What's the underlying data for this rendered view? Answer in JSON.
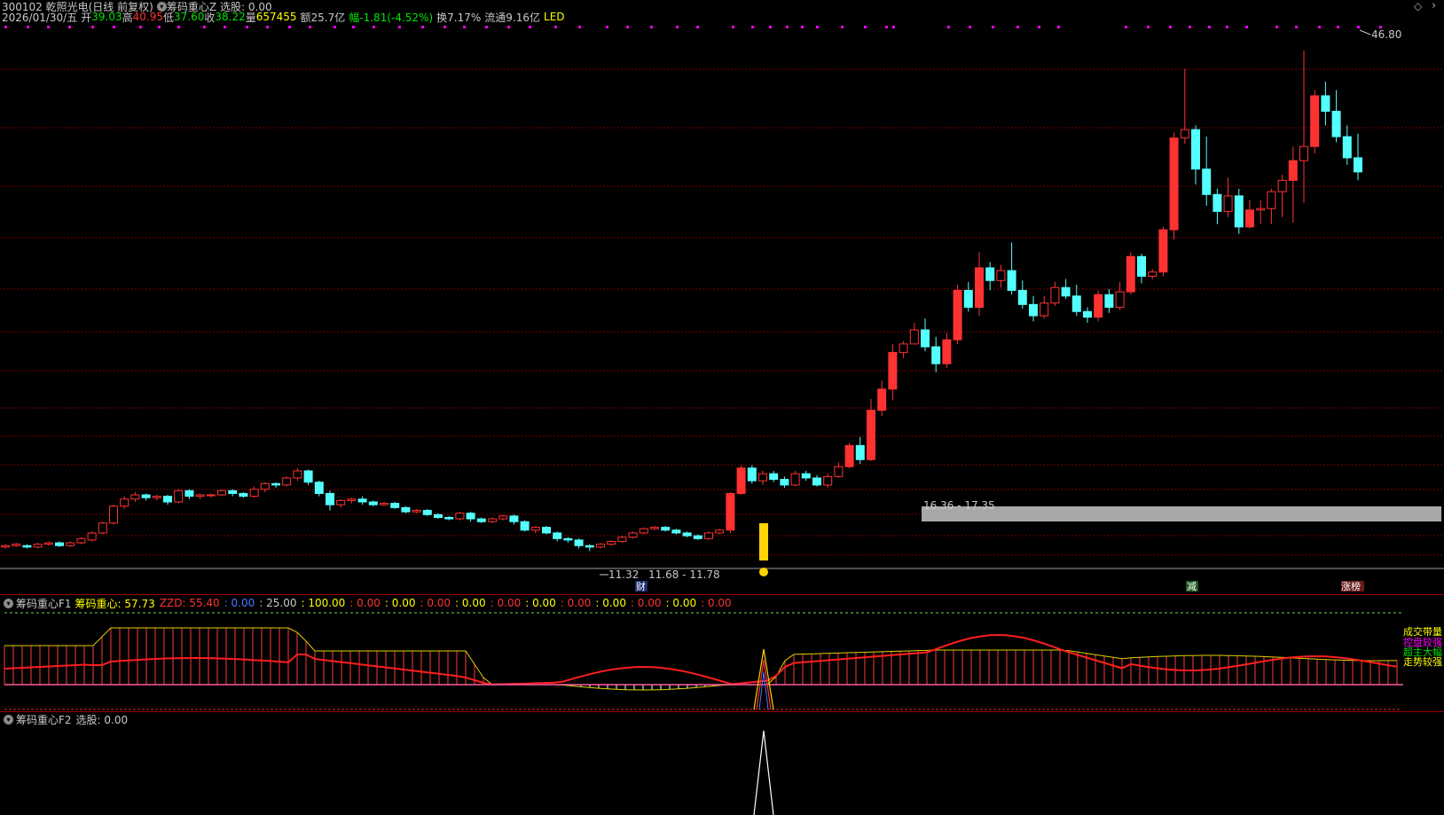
{
  "colors": {
    "up": "#ff3232",
    "down": "#54ffff",
    "grid": "#7a0000",
    "yellow": "#ffff00",
    "white": "#ffffff",
    "green": "#00e600",
    "magenta": "#ff00ff"
  },
  "header": {
    "title": "300102 乾照光电(日线 前复权)",
    "indicator_name": "筹码重心Z",
    "select_label": "选股: 0.00"
  },
  "info": {
    "date": "2026/01/30/五",
    "open_label": "开",
    "open": "39.03",
    "high_label": "高",
    "high": "40.95",
    "low_label": "低",
    "low": "37.60",
    "close_label": "收",
    "close": "38.22",
    "vol_label": "量",
    "vol": "657455",
    "amount": "额25.7亿",
    "change": "幅-1.81(-4.52%)",
    "turnover": "换7.17%",
    "float": "流通9.16亿",
    "sector": "LED"
  },
  "main_chart": {
    "high_mark": "46.80",
    "low_mark": "11.32",
    "low_range": "11.68 - 11.78",
    "band_range": "16.36 - 17.35",
    "event_cai": "财",
    "event_jian": "减",
    "event_zhangbang": "涨榜"
  },
  "chart_data": {
    "type": "candlestick",
    "price_range": [
      10.9,
      48.0
    ],
    "candles": [
      [
        11.6,
        11.7,
        11.5,
        11.8
      ],
      [
        11.7,
        11.8,
        11.6,
        11.9
      ],
      [
        11.7,
        11.6,
        11.5,
        11.8
      ],
      [
        11.6,
        11.8,
        11.5,
        11.9
      ],
      [
        11.8,
        11.9,
        11.7,
        12.0
      ],
      [
        11.9,
        11.7,
        11.6,
        12.0
      ],
      [
        11.7,
        11.9,
        11.6,
        12.0
      ],
      [
        11.9,
        12.2,
        11.8,
        12.3
      ],
      [
        12.1,
        12.6,
        12.0,
        12.7
      ],
      [
        12.6,
        13.3,
        12.5,
        13.4
      ],
      [
        13.3,
        14.5,
        13.2,
        14.6
      ],
      [
        14.5,
        15.0,
        14.3,
        15.2
      ],
      [
        15.0,
        15.3,
        14.8,
        15.5
      ],
      [
        15.3,
        15.1,
        14.9,
        15.4
      ],
      [
        15.1,
        15.2,
        14.9,
        15.3
      ],
      [
        15.2,
        14.8,
        14.6,
        15.3
      ],
      [
        14.8,
        15.6,
        14.7,
        15.7
      ],
      [
        15.6,
        15.2,
        15.0,
        15.7
      ],
      [
        15.2,
        15.3,
        15.0,
        15.4
      ],
      [
        15.3,
        15.3,
        15.1,
        15.4
      ],
      [
        15.3,
        15.6,
        15.2,
        15.7
      ],
      [
        15.6,
        15.4,
        15.2,
        15.7
      ],
      [
        15.4,
        15.2,
        15.1,
        15.5
      ],
      [
        15.2,
        15.7,
        15.1,
        15.9
      ],
      [
        15.7,
        16.1,
        15.5,
        16.2
      ],
      [
        16.1,
        16.0,
        15.8,
        16.2
      ],
      [
        16.0,
        16.5,
        15.9,
        16.6
      ],
      [
        16.5,
        17.0,
        16.3,
        17.2
      ],
      [
        17.0,
        16.2,
        16.0,
        17.1
      ],
      [
        16.2,
        15.4,
        15.2,
        16.3
      ],
      [
        15.4,
        14.6,
        14.2,
        15.6
      ],
      [
        14.6,
        14.9,
        14.4,
        15.0
      ],
      [
        14.9,
        15.0,
        14.7,
        15.1
      ],
      [
        15.0,
        14.8,
        14.6,
        15.2
      ],
      [
        14.8,
        14.6,
        14.5,
        14.9
      ],
      [
        14.6,
        14.7,
        14.5,
        14.8
      ],
      [
        14.7,
        14.4,
        14.3,
        14.8
      ],
      [
        14.4,
        14.1,
        14.0,
        14.5
      ],
      [
        14.1,
        14.2,
        14.0,
        14.3
      ],
      [
        14.2,
        13.9,
        13.8,
        14.3
      ],
      [
        13.9,
        13.7,
        13.6,
        14.0
      ],
      [
        13.7,
        13.6,
        13.5,
        13.8
      ],
      [
        13.6,
        14.0,
        13.5,
        14.1
      ],
      [
        14.0,
        13.6,
        13.4,
        14.1
      ],
      [
        13.6,
        13.4,
        13.3,
        13.7
      ],
      [
        13.4,
        13.6,
        13.3,
        13.7
      ],
      [
        13.6,
        13.8,
        13.5,
        13.9
      ],
      [
        13.8,
        13.4,
        13.2,
        13.9
      ],
      [
        13.4,
        12.8,
        12.7,
        13.5
      ],
      [
        12.8,
        13.0,
        12.6,
        13.1
      ],
      [
        13.0,
        12.6,
        12.5,
        13.1
      ],
      [
        12.6,
        12.2,
        12.0,
        12.7
      ],
      [
        12.2,
        12.1,
        11.9,
        12.3
      ],
      [
        12.1,
        11.7,
        11.5,
        12.2
      ],
      [
        11.7,
        11.6,
        11.32,
        11.8
      ],
      [
        11.6,
        11.8,
        11.5,
        11.9
      ],
      [
        11.8,
        12.0,
        11.7,
        12.1
      ],
      [
        12.0,
        12.3,
        11.9,
        12.4
      ],
      [
        12.3,
        12.6,
        12.2,
        12.7
      ],
      [
        12.6,
        12.9,
        12.5,
        13.0
      ],
      [
        12.9,
        13.0,
        12.8,
        13.1
      ],
      [
        13.0,
        12.8,
        12.7,
        13.1
      ],
      [
        12.8,
        12.6,
        12.5,
        12.9
      ],
      [
        12.6,
        12.4,
        12.3,
        12.7
      ],
      [
        12.4,
        12.2,
        12.1,
        12.5
      ],
      [
        12.2,
        12.6,
        12.1,
        12.7
      ],
      [
        12.6,
        12.8,
        12.5,
        12.9
      ],
      [
        12.8,
        15.4,
        12.6,
        15.5
      ],
      [
        15.4,
        17.2,
        15.3,
        17.4
      ],
      [
        17.2,
        16.3,
        16.1,
        17.4
      ],
      [
        16.3,
        16.8,
        16.0,
        17.0
      ],
      [
        16.8,
        16.4,
        16.2,
        17.0
      ],
      [
        16.4,
        16.0,
        15.8,
        16.6
      ],
      [
        16.0,
        16.8,
        15.9,
        17.0
      ],
      [
        16.8,
        16.5,
        16.3,
        17.0
      ],
      [
        16.5,
        16.0,
        15.9,
        16.7
      ],
      [
        16.0,
        16.6,
        15.8,
        16.8
      ],
      [
        16.6,
        17.3,
        16.5,
        17.6
      ],
      [
        17.3,
        18.8,
        17.2,
        19.0
      ],
      [
        18.8,
        17.8,
        17.5,
        19.4
      ],
      [
        17.8,
        21.3,
        17.7,
        22.1
      ],
      [
        21.3,
        22.8,
        20.9,
        23.4
      ],
      [
        22.8,
        25.4,
        22.0,
        26.0
      ],
      [
        25.4,
        26.0,
        25.0,
        26.2
      ],
      [
        26.0,
        27.0,
        26.0,
        27.5
      ],
      [
        27.0,
        25.8,
        25.5,
        27.8
      ],
      [
        25.8,
        24.6,
        24.0,
        26.5
      ],
      [
        24.6,
        26.3,
        24.3,
        26.8
      ],
      [
        26.3,
        29.8,
        26.0,
        30.2
      ],
      [
        29.8,
        28.6,
        28.3,
        30.4
      ],
      [
        28.6,
        31.4,
        28.0,
        32.5
      ],
      [
        31.4,
        30.5,
        29.8,
        31.8
      ],
      [
        30.5,
        31.2,
        30.0,
        31.6
      ],
      [
        31.2,
        29.8,
        29.5,
        33.2
      ],
      [
        29.8,
        28.8,
        28.5,
        30.5
      ],
      [
        28.8,
        28.0,
        27.6,
        29.4
      ],
      [
        28.0,
        28.9,
        27.8,
        29.4
      ],
      [
        28.9,
        30.0,
        28.7,
        30.4
      ],
      [
        30.0,
        29.4,
        29.2,
        30.6
      ],
      [
        29.4,
        28.3,
        28.0,
        30.2
      ],
      [
        28.3,
        27.9,
        27.5,
        28.6
      ],
      [
        27.9,
        29.5,
        27.6,
        29.8
      ],
      [
        29.5,
        28.6,
        28.2,
        29.9
      ],
      [
        28.6,
        29.7,
        28.4,
        30.4
      ],
      [
        29.7,
        32.2,
        29.5,
        32.5
      ],
      [
        32.2,
        30.8,
        30.3,
        32.4
      ],
      [
        30.8,
        31.1,
        30.6,
        31.3
      ],
      [
        31.1,
        34.1,
        30.8,
        34.3
      ],
      [
        34.1,
        40.6,
        33.4,
        41.0
      ],
      [
        40.6,
        41.2,
        40.2,
        45.5
      ],
      [
        41.2,
        38.4,
        37.3,
        41.5
      ],
      [
        38.4,
        36.6,
        35.8,
        40.7
      ],
      [
        36.6,
        35.4,
        34.5,
        37.0
      ],
      [
        35.4,
        36.5,
        35.0,
        37.8
      ],
      [
        36.5,
        34.3,
        33.8,
        37.0
      ],
      [
        34.3,
        35.5,
        34.2,
        36.2
      ],
      [
        35.5,
        35.6,
        34.5,
        36.2
      ],
      [
        35.6,
        36.8,
        34.5,
        37.0
      ],
      [
        36.8,
        37.6,
        35.0,
        38.0
      ],
      [
        37.6,
        39.0,
        34.6,
        40.0
      ],
      [
        39.0,
        40.0,
        36.0,
        46.8
      ],
      [
        40.0,
        43.6,
        39.5,
        44.0
      ],
      [
        43.6,
        42.5,
        41.5,
        44.6
      ],
      [
        42.5,
        40.7,
        40.3,
        44.0
      ],
      [
        40.7,
        39.2,
        38.7,
        41.5
      ],
      [
        39.2,
        38.2,
        37.6,
        40.9
      ]
    ]
  },
  "panel_f1": {
    "name": "筹码重心F1",
    "values": [
      {
        "label": "筹码重心: 57.73",
        "color": "#ffff00"
      },
      {
        "label": "ZZD: 55.40",
        "color": "#ff3232"
      },
      {
        "label": ": 0.00",
        "color": "#4a78ff"
      },
      {
        "label": ": 25.00",
        "color": "#c8c8c8"
      },
      {
        "label": ": 100.00",
        "color": "#ffff00"
      },
      {
        "label": ": 0.00",
        "color": "#ff3232"
      },
      {
        "label": ": 0.00",
        "color": "#ffff00"
      },
      {
        "label": ": 0.00",
        "color": "#ff3232"
      },
      {
        "label": ": 0.00",
        "color": "#ffff00"
      },
      {
        "label": ": 0.00",
        "color": "#ff3232"
      },
      {
        "label": ": 0.00",
        "color": "#ffff00"
      },
      {
        "label": ": 0.00",
        "color": "#ff3232"
      },
      {
        "label": ": 0.00",
        "color": "#ffff00"
      },
      {
        "label": ": 0.00",
        "color": "#ff3232"
      },
      {
        "label": ": 0.00",
        "color": "#ffff00"
      },
      {
        "label": ": 0.00",
        "color": "#ff3232"
      }
    ],
    "right_labels": [
      {
        "text": "成交带量",
        "color": "#ffff00"
      },
      {
        "text": "控盘较强",
        "color": "#ff00ff"
      },
      {
        "text": "超主大幅",
        "color": "#00e600"
      },
      {
        "text": "走势较强",
        "color": "#ffff00"
      }
    ]
  },
  "panel_f2": {
    "name": "筹码重心F2",
    "select_label": "选股: 0.00"
  }
}
